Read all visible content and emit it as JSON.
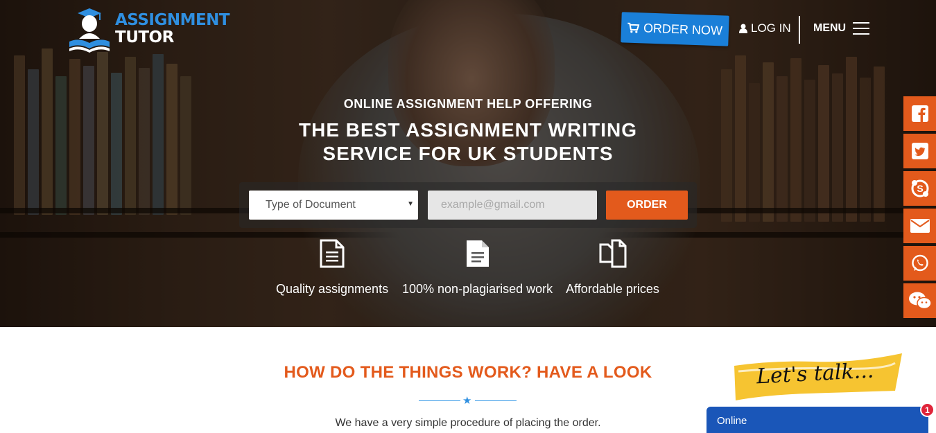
{
  "brand": {
    "line1": "ASSIGNMENT",
    "line2": "TUTOR"
  },
  "nav": {
    "order_now": "ORDER NOW",
    "login": "LOG IN",
    "menu": "MENU"
  },
  "hero": {
    "subtitle": "ONLINE ASSIGNMENT HELP OFFERING",
    "title_line1": "THE BEST ASSIGNMENT WRITING",
    "title_line2": "SERVICE FOR UK STUDENTS"
  },
  "order_form": {
    "document_type_selected": "Type of Document",
    "email_placeholder": "example@gmail.com",
    "email_value": "",
    "submit_label": "ORDER"
  },
  "features": [
    {
      "icon": "document-lines-icon",
      "label": "Quality assignments"
    },
    {
      "icon": "document-text-icon",
      "label": "100% non-plagiarised work"
    },
    {
      "icon": "copy-documents-icon",
      "label": "Affordable prices"
    }
  ],
  "social": [
    "facebook-icon",
    "twitter-icon",
    "skype-icon",
    "email-icon",
    "whatsapp-icon",
    "wechat-icon"
  ],
  "section": {
    "heading": "HOW DO THE THINGS WORK? HAVE A LOOK",
    "intro": "We have a very simple procedure of placing the order."
  },
  "chat_widget": {
    "talk_label": "Let's talk...",
    "status": "Online",
    "unread_count": "1"
  },
  "colors": {
    "accent_orange": "#e35a1c",
    "brand_blue": "#2f8fe0",
    "chat_blue": "#1a56b8"
  }
}
